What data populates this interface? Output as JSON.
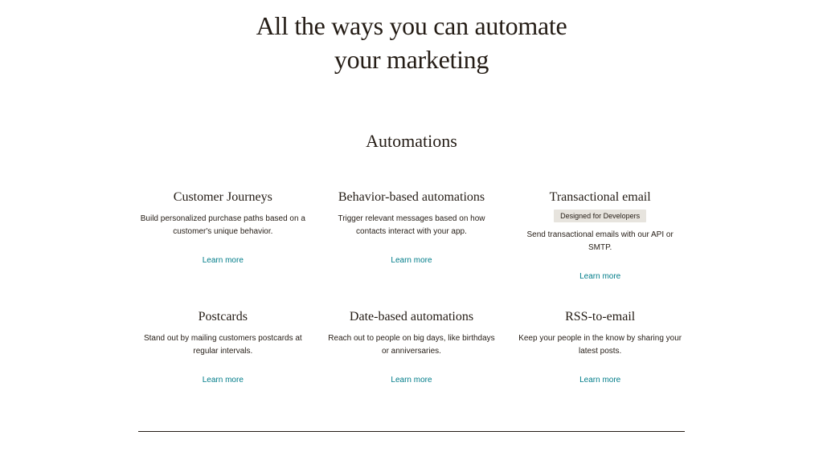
{
  "header": {
    "title_line1": "All the ways you can automate",
    "title_line2": "your marketing"
  },
  "section": {
    "title": "Automations"
  },
  "cards": [
    {
      "title": "Customer Journeys",
      "badge": null,
      "desc": "Build personalized purchase paths based on a customer's unique behavior.",
      "link": "Learn more"
    },
    {
      "title": "Behavior-based automations",
      "badge": null,
      "desc": "Trigger relevant messages based on how contacts interact with your app.",
      "link": "Learn more"
    },
    {
      "title": "Transactional email",
      "badge": "Designed for Developers",
      "desc": "Send transactional emails with our API or SMTP.",
      "link": "Learn more"
    },
    {
      "title": "Postcards",
      "badge": null,
      "desc": "Stand out by mailing customers postcards at regular intervals.",
      "link": "Learn more"
    },
    {
      "title": "Date-based automations",
      "badge": null,
      "desc": "Reach out to people on big days, like birthdays or anniversaries.",
      "link": "Learn more"
    },
    {
      "title": "RSS-to-email",
      "badge": null,
      "desc": "Keep your people in the know by sharing your latest posts.",
      "link": "Learn more"
    }
  ]
}
